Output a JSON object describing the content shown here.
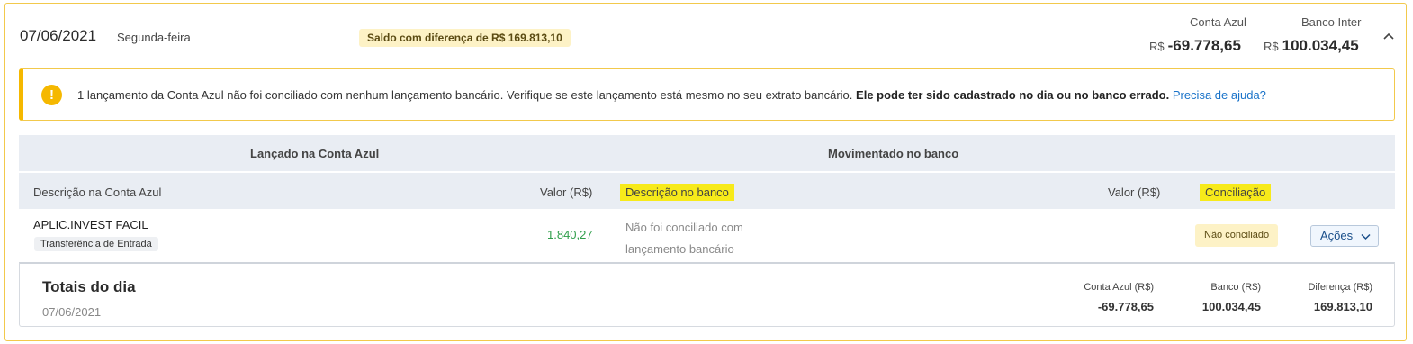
{
  "header": {
    "date": "07/06/2021",
    "weekday": "Segunda-feira",
    "diff_badge": "Saldo com diferença de R$ 169.813,10",
    "conta_azul_label": "Conta Azul",
    "banco_label": "Banco Inter",
    "currency": "R$",
    "conta_azul_balance": "-69.778,65",
    "banco_balance": "100.034,45"
  },
  "alert": {
    "text": "1 lançamento da Conta Azul não foi conciliado com nenhum lançamento bancário. Verifique se este lançamento está mesmo no seu extrato bancário.",
    "bold_text": "Ele pode ter sido cadastrado no dia ou no banco errado.",
    "link": "Precisa de ajuda?"
  },
  "table": {
    "group_left": "Lançado na Conta Azul",
    "group_right": "Movimentado no banco",
    "columns": {
      "descricao_ca": "Descrição na Conta Azul",
      "valor_ca": "Valor (R$)",
      "descricao_banco": "Descrição no banco",
      "valor_banco": "Valor (R$)",
      "conciliacao": "Conciliação"
    },
    "rows": [
      {
        "descricao": "APLIC.INVEST FACIL",
        "tag": "Transferência de Entrada",
        "valor": "1.840,27",
        "banco_desc": "Não foi conciliado com lançamento bancário",
        "status": "Não conciliado",
        "action": "Ações"
      }
    ]
  },
  "totals": {
    "title": "Totais do dia",
    "date": "07/06/2021",
    "conta_azul_label": "Conta Azul (R$)",
    "banco_label": "Banco (R$)",
    "diferenca_label": "Diferença (R$)",
    "conta_azul_value": "-69.778,65",
    "banco_value": "100.034,45",
    "diferenca_value": "169.813,10"
  },
  "colors": {
    "accent_yellow": "#f5b800",
    "highlight": "#f7ea1a",
    "positive": "#2e9e4a",
    "link": "#1a73c9"
  }
}
